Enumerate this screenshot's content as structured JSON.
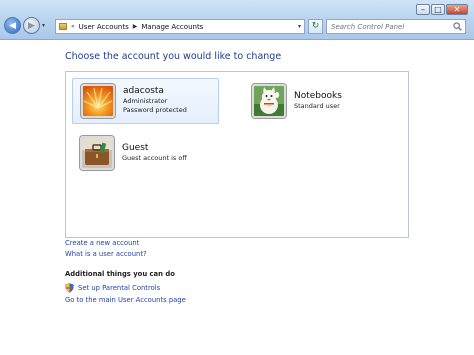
{
  "address_bar": {
    "crumbs": [
      "User Accounts",
      "Manage Accounts"
    ]
  },
  "search": {
    "placeholder": "Search Control Panel"
  },
  "window_buttons": {
    "minimize": "–",
    "maximize": "□",
    "close": "✕"
  },
  "nav": {
    "back": "◀",
    "forward": "▶",
    "dropdown": "▾",
    "refresh": "↻"
  },
  "main": {
    "title": "Choose the account you would like to change",
    "accounts": [
      {
        "name": "adacosta",
        "line1": "Administrator",
        "line2": "Password protected",
        "picture": "orange-flower",
        "selected": true
      },
      {
        "name": "Notebooks",
        "line1": "Standard user",
        "line2": "",
        "picture": "lucky-cat",
        "selected": false
      },
      {
        "name": "Guest",
        "line1": "Guest account is off",
        "line2": "",
        "picture": "suitcase",
        "selected": false
      }
    ]
  },
  "links": {
    "create": "Create a new account",
    "what_is": "What is a user account?",
    "additional_heading": "Additional things you can do",
    "parental": "Set up Parental Controls",
    "main_page": "Go to the main User Accounts page"
  },
  "colors": {
    "link": "#1f43ad",
    "title": "#1e3d8f",
    "chrome": "#bcd6f0"
  }
}
